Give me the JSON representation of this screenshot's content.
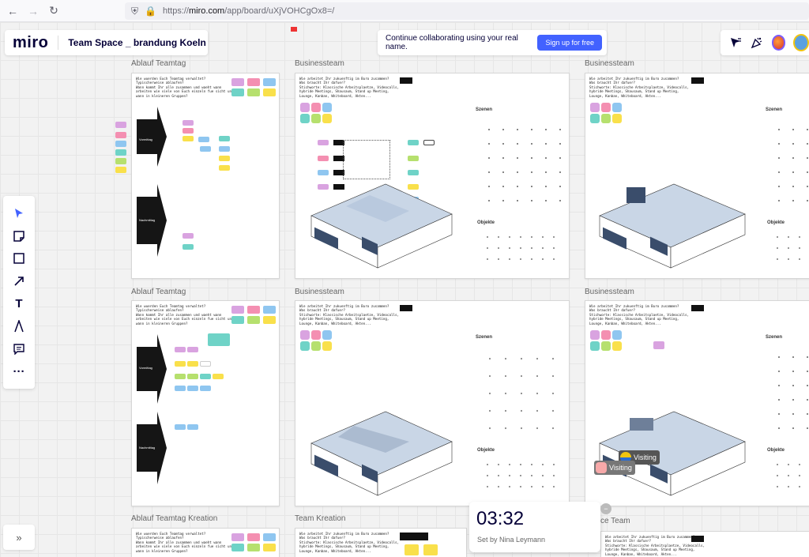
{
  "browser": {
    "url_prefix": "https://",
    "url_host": "miro.com",
    "url_path": "/app/board/uXjVOHCgOx8=/"
  },
  "app": {
    "logo": "miro",
    "board_title": "Team Space _ brandung Koeln"
  },
  "banner": {
    "text": "Continue collaborating using your real name.",
    "button": "Sign up for free"
  },
  "frames": {
    "f1": "Ablauf Teamtag",
    "f2": "Businessteam",
    "f3": "Businessteam",
    "f4": "Ablauf Teamtag",
    "f5": "Businessteam",
    "f6": "Businessteam",
    "f7": "Ablauf Teamtag Kreation",
    "f8": "Team Kreation",
    "f9": "ce Team"
  },
  "frame_text": {
    "teamtag": "Wie wuerden Euch Teamtag verwaltet?\nTypischerweise ablaufen?\nWann kommt Ihr alle zusammen und waeht wann\narbeiten wie viele von Euch einzeln fue sicht und\nwann in kleineren Gruppen?",
    "business": "Wie arbeitet Ihr zukuenftig im Buro zusammen?\nWas braucht Ihr dafuer?\nStichworte: Klassische Arbeitsplaetze, Videocalls,\nhybride Meetings, Shausaum, Stand up Meeting,\nLounge, Kanban, Whiteboard, Akten..."
  },
  "labels": {
    "szenen": "Szenen",
    "objekte": "Objekte",
    "vormittag": "Vormittag",
    "nachmittag": "Nachmittag"
  },
  "timer": {
    "value": "03:32",
    "set_by": "Set by Nina Leymann"
  },
  "visiting": {
    "label1": "Visiting",
    "label2": "Visiting"
  },
  "colors": {
    "accent": "#4262ff",
    "sticky_purple": "#d9a3e0",
    "sticky_pink": "#f48fb1",
    "sticky_blue": "#8fc6f0",
    "sticky_yellow": "#f9e04b",
    "sticky_green": "#b6e06e",
    "sticky_teal": "#6fd3c7"
  },
  "icons": {
    "back": "arrow-left-icon",
    "forward": "arrow-right-icon",
    "reload": "reload-icon",
    "shield": "shield-icon",
    "lock": "lock-icon"
  }
}
